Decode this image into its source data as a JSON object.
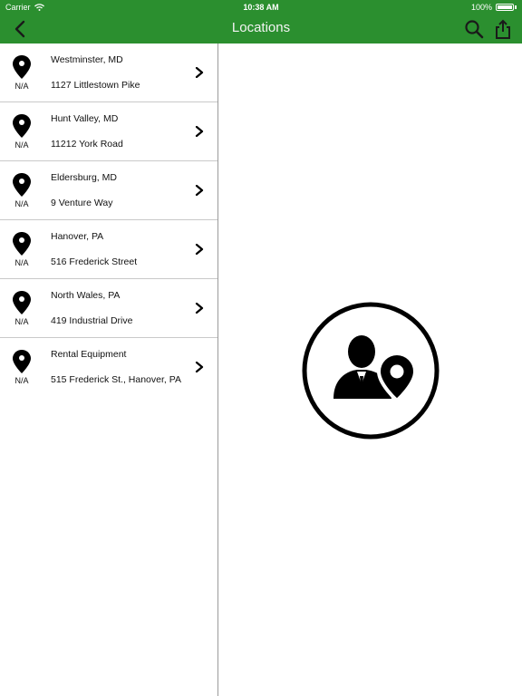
{
  "status_bar": {
    "carrier": "Carrier",
    "time": "10:38 AM",
    "battery": "100%"
  },
  "nav": {
    "title": "Locations",
    "back_icon": "chevron-left-icon",
    "search_icon": "search-icon",
    "share_icon": "share-icon"
  },
  "colors": {
    "header": "#2b8f2f",
    "text": "#111111",
    "divider": "#c9c9c9"
  },
  "locations": [
    {
      "name": "Westminster, MD",
      "address": "1127 Littlestown Pike",
      "distance": "N/A"
    },
    {
      "name": "Hunt Valley, MD",
      "address": "11212 York Road",
      "distance": "N/A"
    },
    {
      "name": "Eldersburg, MD",
      "address": "9 Venture Way",
      "distance": "N/A"
    },
    {
      "name": "Hanover, PA",
      "address": "516 Frederick Street",
      "distance": "N/A"
    },
    {
      "name": "North Wales, PA",
      "address": "419 Industrial Drive",
      "distance": "N/A"
    },
    {
      "name": "Rental Equipment",
      "address": "515 Frederick St., Hanover, PA",
      "distance": "N/A"
    }
  ],
  "detail": {
    "placeholder_icon": "person-location-icon"
  }
}
